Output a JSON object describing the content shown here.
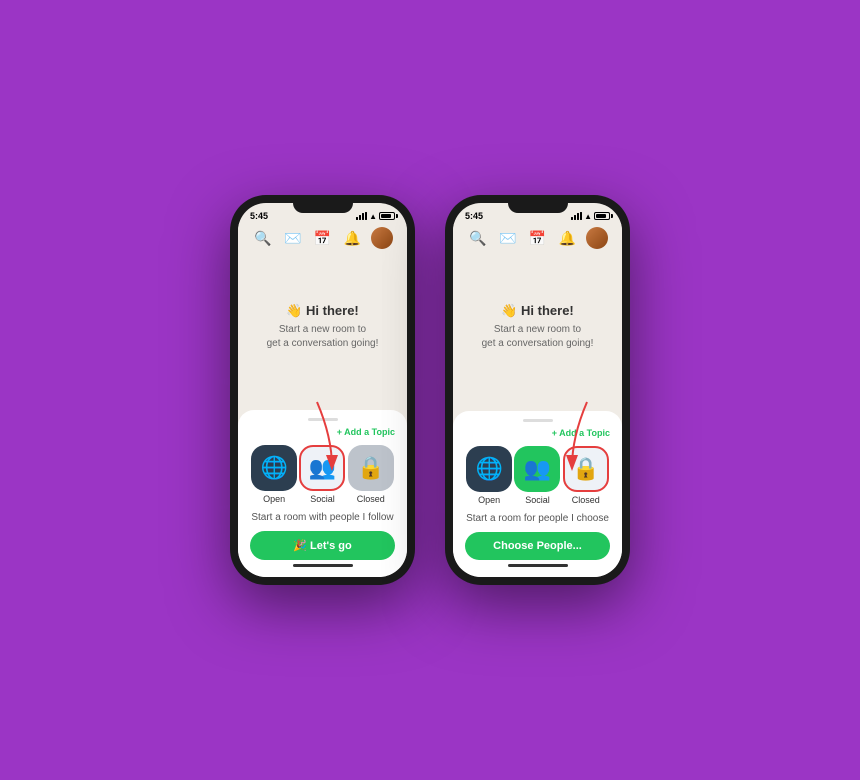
{
  "background_color": "#9B35C5",
  "phones": [
    {
      "id": "left-phone",
      "status_bar": {
        "time": "5:45",
        "signal": true,
        "wifi": true,
        "battery": true
      },
      "nav": {
        "icons": [
          "search",
          "compose",
          "calendar",
          "bell",
          "avatar"
        ]
      },
      "main": {
        "greeting": "👋 Hi there!",
        "subtitle_line1": "Start a new room to",
        "subtitle_line2": "get a conversation going!"
      },
      "bottom_sheet": {
        "add_topic_label": "+ Add a Topic",
        "room_types": [
          {
            "id": "open",
            "emoji": "🌐",
            "label": "Open",
            "style": "dark",
            "selected": false
          },
          {
            "id": "social",
            "emoji": "👥",
            "label": "Social",
            "style": "green",
            "selected": true
          },
          {
            "id": "closed",
            "emoji": "🔒",
            "label": "Closed",
            "style": "gray",
            "selected": false
          }
        ],
        "description": "Start a room with people I follow",
        "action_button_label": "🎉 Let's go"
      }
    },
    {
      "id": "right-phone",
      "status_bar": {
        "time": "5:45",
        "signal": true,
        "wifi": true,
        "battery": true
      },
      "nav": {
        "icons": [
          "search",
          "compose",
          "calendar",
          "bell",
          "avatar"
        ]
      },
      "main": {
        "greeting": "👋 Hi there!",
        "subtitle_line1": "Start a new room to",
        "subtitle_line2": "get a conversation going!"
      },
      "bottom_sheet": {
        "add_topic_label": "+ Add a Topic",
        "room_types": [
          {
            "id": "open",
            "emoji": "🌐",
            "label": "Open",
            "style": "dark",
            "selected": false
          },
          {
            "id": "social",
            "emoji": "👥",
            "label": "Social",
            "style": "green",
            "selected": false
          },
          {
            "id": "closed",
            "emoji": "🔒",
            "label": "Closed",
            "style": "gray",
            "selected": true
          }
        ],
        "description": "Start a room for people I choose",
        "action_button_label": "Choose People..."
      }
    }
  ]
}
